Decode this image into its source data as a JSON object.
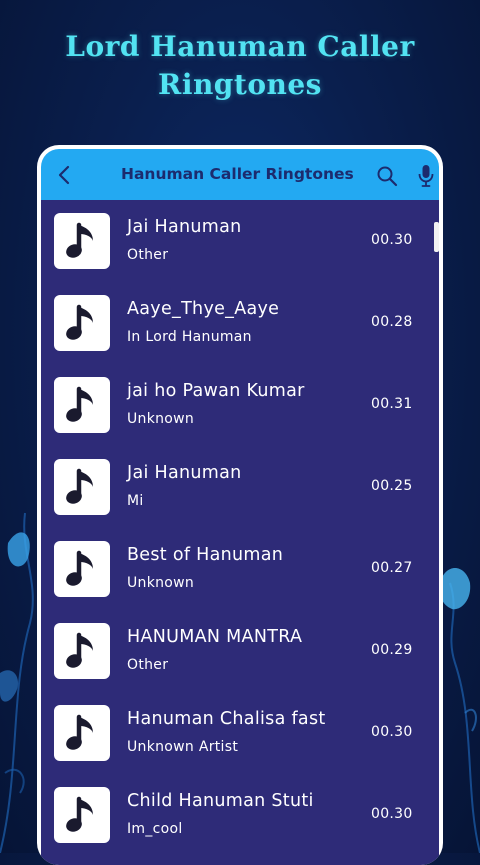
{
  "banner": {
    "line1": "Lord Hanuman Caller",
    "line2": "Ringtones"
  },
  "header": {
    "title": "Hanuman Caller Ringtones",
    "back_icon": "chevron-left-icon",
    "search_icon": "search-icon",
    "mic_icon": "microphone-icon"
  },
  "colors": {
    "header_bg": "#23a9f2",
    "list_bg": "#2e2b78",
    "headline": "#52e3f2",
    "header_title": "#1c2b6e"
  },
  "songs": [
    {
      "title": "Jai Hanuman",
      "artist": "Other",
      "duration": "00.30"
    },
    {
      "title": "Aaye_Thye_Aaye",
      "artist": "In Lord Hanuman",
      "duration": "00.28"
    },
    {
      "title": "jai ho Pawan Kumar",
      "artist": "Unknown",
      "duration": "00.31"
    },
    {
      "title": "Jai Hanuman",
      "artist": "Mi",
      "duration": "00.25"
    },
    {
      "title": "Best of Hanuman",
      "artist": "Unknown",
      "duration": "00.27"
    },
    {
      "title": "HANUMAN MANTRA",
      "artist": "Other",
      "duration": "00.29"
    },
    {
      "title": "Hanuman Chalisa fast",
      "artist": "Unknown Artist",
      "duration": "00.30"
    },
    {
      "title": "Child Hanuman Stuti",
      "artist": "Im_cool",
      "duration": "00.30"
    }
  ]
}
